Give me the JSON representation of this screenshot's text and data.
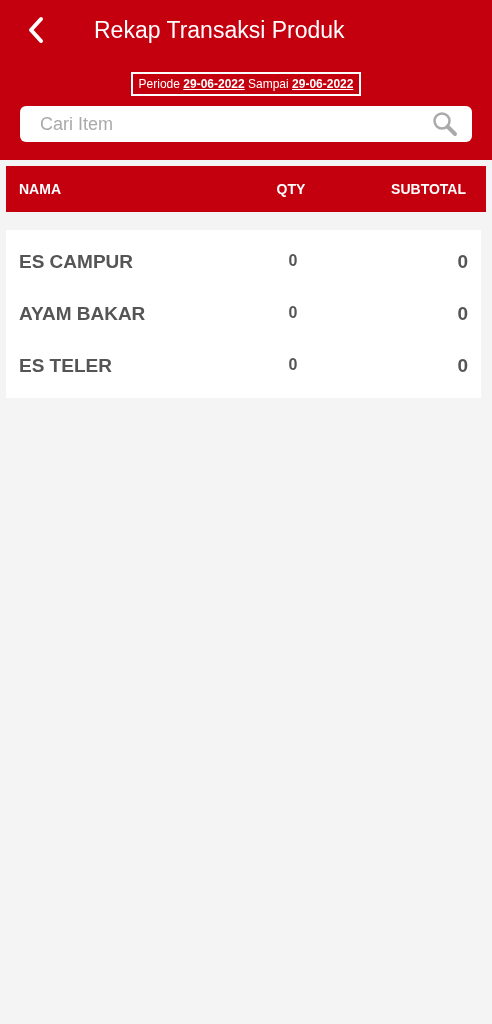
{
  "header": {
    "title": "Rekap Transaksi Produk",
    "period": "Periode **29-06-2022** Sampai **29-06-2022**"
  },
  "search": {
    "placeholder": "Cari Item"
  },
  "table": {
    "columns": [
      "NAMA",
      "QTY",
      "SUBTOTAL"
    ],
    "rows": [
      {
        "name": "ES CAMPUR",
        "qty": "0",
        "subtotal": "0"
      },
      {
        "name": "AYAM BAKAR",
        "qty": "0",
        "subtotal": "0"
      },
      {
        "name": "ES TELER",
        "qty": "0",
        "subtotal": "0"
      }
    ]
  }
}
